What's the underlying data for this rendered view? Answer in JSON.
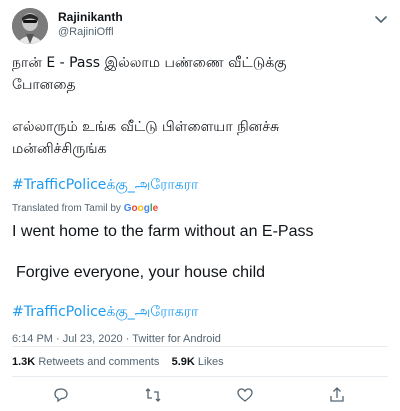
{
  "user": {
    "display_name": "Rajinikanth",
    "handle": "@RajiniOffl"
  },
  "tweet": {
    "tamil_line1": "நான் E - Pass இல்லாம பண்ணை வீட்டுக்கு",
    "tamil_line2": "போனதை",
    "tamil_line3": "எல்லாரும் உங்க வீட்டு பிள்ளையா நினச்சு",
    "tamil_line4": "மன்னிச்சிருங்க",
    "hashtag": "#TrafficPoliceக்கு_அரோகரா",
    "translated_prefix": "Translated from Tamil by",
    "translated_google": [
      "G",
      "o",
      "o",
      "g",
      "l",
      "e"
    ],
    "en_line1": "I went home to the farm without an E-Pass",
    "en_line2": "Forgive everyone, your house child",
    "en_hashtag": "#TrafficPoliceக்கு_அரோகரா",
    "time": "6:14 PM · Jul 23, 2020 · ",
    "source": "Twitter for Android"
  },
  "stats": {
    "retweets_count": "1.3K",
    "retweets_label": "Retweets and comments",
    "likes_count": "5.9K",
    "likes_label": "Likes"
  },
  "icons": {
    "reply": "reply-icon",
    "retweet": "retweet-icon",
    "like": "heart-icon",
    "share": "share-icon",
    "menu": "chevron-down-icon"
  },
  "colors": {
    "hashtag": "#1d9bf0",
    "muted": "#536471"
  }
}
